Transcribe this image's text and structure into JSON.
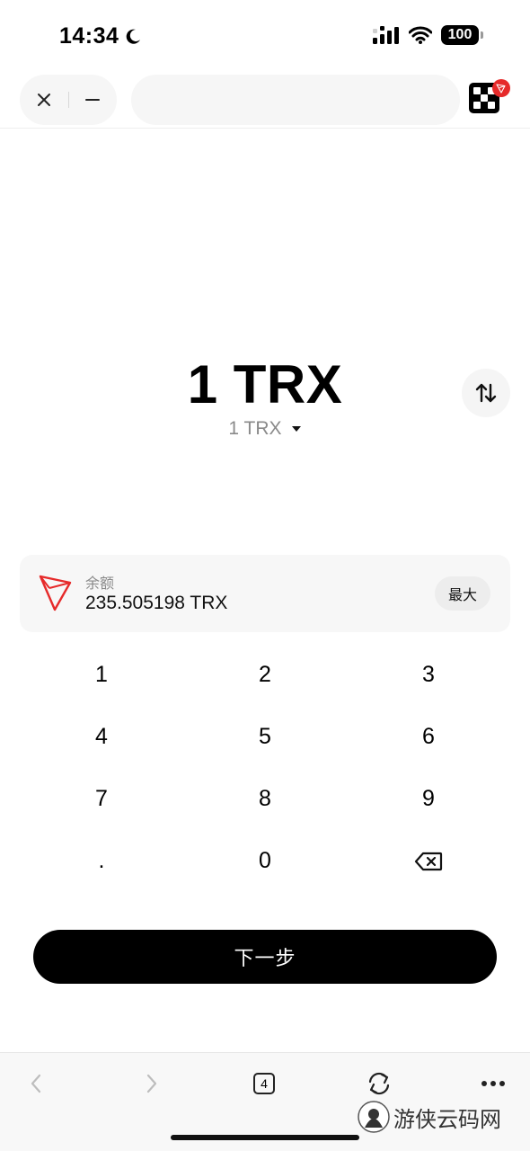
{
  "status_bar": {
    "time": "14:34",
    "battery": "100",
    "icons": [
      "moon-icon",
      "cellular-signal-icon",
      "wifi-icon",
      "battery-icon"
    ]
  },
  "top_bar": {
    "icons": [
      "close-icon",
      "minimize-icon",
      "app-logo-icon",
      "tron-badge-icon"
    ],
    "url": ""
  },
  "amount": {
    "main": "1 TRX",
    "secondary": "1  TRX",
    "secondary_icon": "caret-down-icon",
    "swap_icon": "swap-vertical-icon"
  },
  "balance": {
    "token_icon": "tron-logo-icon",
    "label": "余额",
    "value": "235.505198  TRX",
    "max_label": "最大"
  },
  "keypad": {
    "keys": [
      "1",
      "2",
      "3",
      "4",
      "5",
      "6",
      "7",
      "8",
      "9",
      ".",
      "0",
      ""
    ],
    "backspace_icon": "backspace-icon"
  },
  "next_button": {
    "label": "下一步"
  },
  "bottom_toolbar": {
    "tab_count": "4",
    "icons": [
      "back-icon",
      "forward-icon",
      "tabs-icon",
      "refresh-icon",
      "more-icon"
    ]
  },
  "watermark": {
    "text": "游侠云码网"
  },
  "colors": {
    "accent": "#000000",
    "tron_red": "#e62a2a",
    "card_bg": "#f7f7f7"
  }
}
